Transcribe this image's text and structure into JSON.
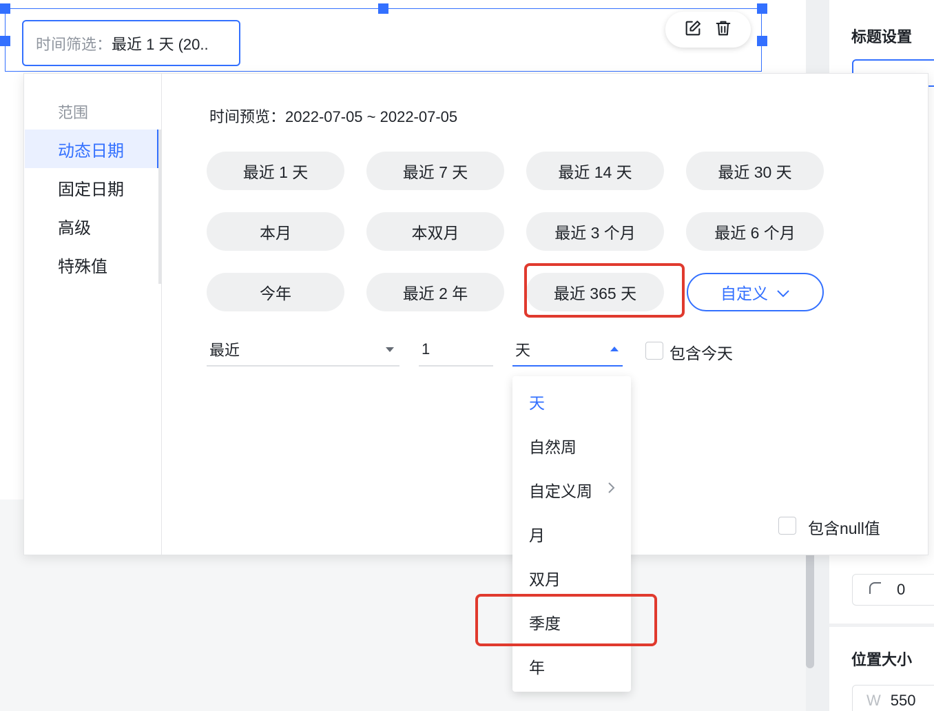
{
  "widget": {
    "filter_label": "时间筛选：",
    "filter_value": "最近 1 天 (20.."
  },
  "popover": {
    "sidebar": {
      "heading": "范围",
      "items": [
        {
          "label": "动态日期",
          "active": true
        },
        {
          "label": "固定日期",
          "active": false
        },
        {
          "label": "高级",
          "active": false
        },
        {
          "label": "特殊值",
          "active": false
        }
      ]
    },
    "preview": "时间预览：2022-07-05 ~ 2022-07-05",
    "presets": [
      "最近 1 天",
      "最近 7 天",
      "最近 14 天",
      "最近 30 天",
      "本月",
      "本双月",
      "最近 3 个月",
      "最近 6 个月",
      "今年",
      "最近 2 年",
      "最近 365 天"
    ],
    "custom_label": "自定义",
    "range": {
      "direction": "最近",
      "amount": "1",
      "unit": "天"
    },
    "include_today": {
      "label": "包含今天",
      "checked": false
    },
    "include_null": {
      "label": "包含null值",
      "checked": false
    },
    "unit_menu": {
      "items": [
        "天",
        "自然周",
        "自定义周",
        "月",
        "双月",
        "季度",
        "年"
      ],
      "selected": "天"
    }
  },
  "right_panel": {
    "title_settings": "标题设置",
    "radius_value": "0",
    "position_size": "位置大小",
    "width_prefix": "W",
    "width_value": "550"
  },
  "colors": {
    "accent": "#3370ff",
    "highlight": "#e03a2e",
    "pill_bg": "#eff0f1"
  }
}
